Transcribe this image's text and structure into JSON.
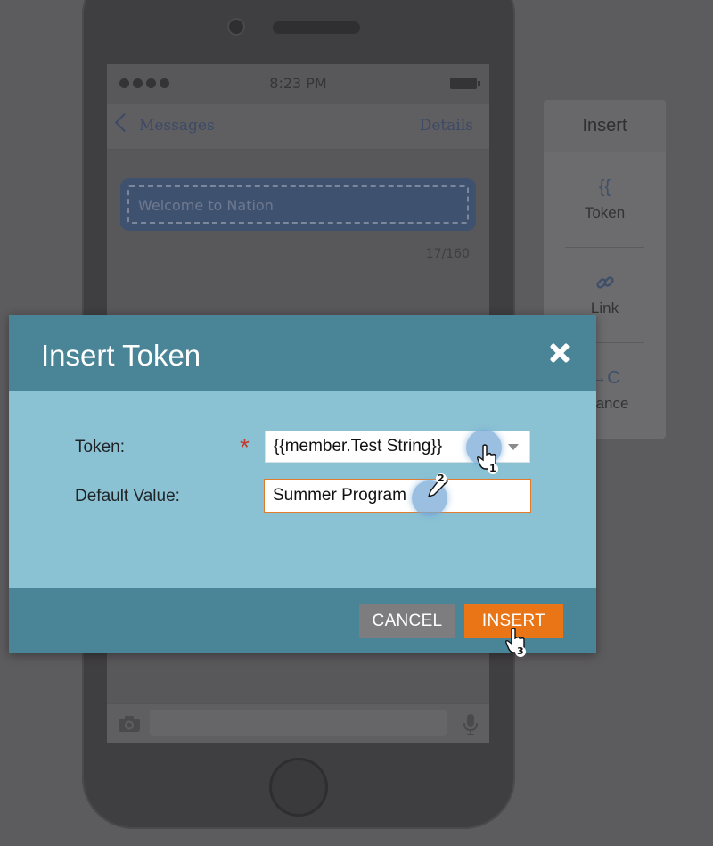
{
  "phone": {
    "status_time": "8:23 PM",
    "nav_back_label": "Messages",
    "nav_details_label": "Details",
    "message_placeholder": "Welcome to Nation",
    "char_counter": "17/160"
  },
  "insert_panel": {
    "title": "Insert",
    "items": [
      {
        "icon": "{{",
        "label": "Token"
      },
      {
        "icon": "link-icon",
        "label": "Link"
      },
      {
        "icon": "↔C",
        "label": "pliance"
      }
    ]
  },
  "modal": {
    "title": "Insert Token",
    "token_label": "Token:",
    "token_required_mark": "*",
    "token_value": "{{member.Test String}}",
    "default_value_label": "Default Value:",
    "default_value": "Summer Program",
    "cancel_label": "CANCEL",
    "insert_label": "INSERT"
  },
  "steps": [
    "1",
    "2",
    "3"
  ],
  "colors": {
    "header": "#4a8497",
    "body": "#8bc2d3",
    "insert_button": "#ea7517",
    "cancel_button": "#7d7c7f",
    "required": "#c73a2a"
  }
}
